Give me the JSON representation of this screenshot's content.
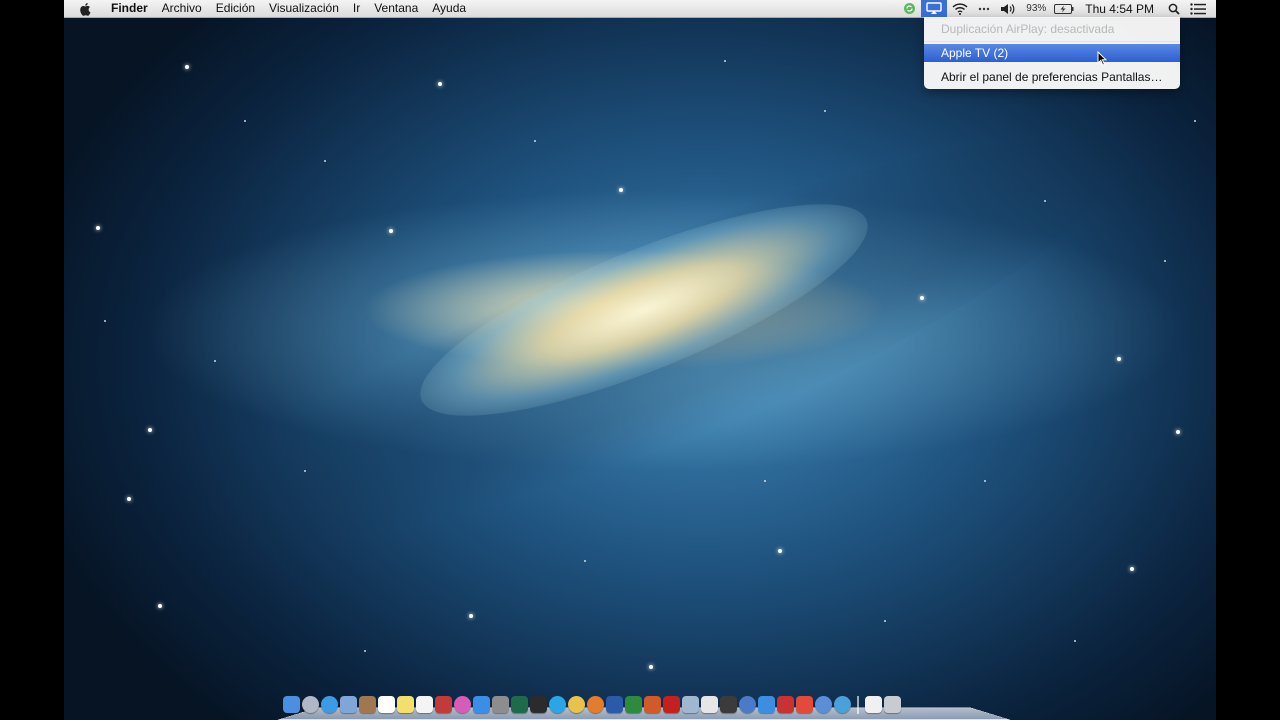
{
  "menubar": {
    "apple_icon": "apple-logo-icon",
    "app_name": "Finder",
    "items": [
      "Archivo",
      "Edición",
      "Visualización",
      "Ir",
      "Ventana",
      "Ayuda"
    ]
  },
  "status_bar": {
    "icons": [
      "sync-icon",
      "airplay-icon",
      "wifi-icon",
      "bluetooth-icon",
      "volume-icon"
    ],
    "battery_percent": "93%",
    "battery_icon": "battery-charging-icon",
    "clock": "Thu 4:54 PM",
    "spotlight_icon": "spotlight-search-icon",
    "notifications_icon": "notification-center-icon"
  },
  "airplay_menu": {
    "disabled_item": "Duplicación AirPlay: desactivada",
    "highlighted_item": "Apple TV (2)",
    "normal_item": "Abrir el panel de preferencias Pantallas…"
  },
  "dock": {
    "icons": [
      {
        "name": "finder-icon",
        "color": "#4a8fe0"
      },
      {
        "name": "launchpad-icon",
        "color": "#b0b8c8"
      },
      {
        "name": "safari-icon",
        "color": "#3d9be6"
      },
      {
        "name": "mail-icon",
        "color": "#7fa6d6"
      },
      {
        "name": "contacts-icon",
        "color": "#a07850"
      },
      {
        "name": "calendar-icon",
        "color": "#ffffff"
      },
      {
        "name": "notes-icon",
        "color": "#f3df6b"
      },
      {
        "name": "reminders-icon",
        "color": "#f4f4f4"
      },
      {
        "name": "photo-booth-icon",
        "color": "#c43a3a"
      },
      {
        "name": "itunes-icon",
        "color": "#d95bb8"
      },
      {
        "name": "app-store-icon",
        "color": "#3a8ee6"
      },
      {
        "name": "system-preferences-icon",
        "color": "#8d8d8d"
      },
      {
        "name": "audition-icon",
        "color": "#1e6b4a"
      },
      {
        "name": "terminal-icon",
        "color": "#2b2b2b"
      },
      {
        "name": "skype-icon",
        "color": "#2aa6e6"
      },
      {
        "name": "chrome-icon",
        "color": "#e8c24a"
      },
      {
        "name": "firefox-icon",
        "color": "#e57c2c"
      },
      {
        "name": "word-icon",
        "color": "#2a5aa8"
      },
      {
        "name": "excel-icon",
        "color": "#2e8a3e"
      },
      {
        "name": "powerpoint-icon",
        "color": "#d05a2a"
      },
      {
        "name": "acrobat-icon",
        "color": "#c42020"
      },
      {
        "name": "preview-icon",
        "color": "#9fb8d0"
      },
      {
        "name": "textedit-icon",
        "color": "#e6e6e6"
      },
      {
        "name": "dashboard-icon",
        "color": "#3b3b3b"
      },
      {
        "name": "quicktime-icon",
        "color": "#4a7ac8"
      },
      {
        "name": "dropbox-icon",
        "color": "#3d8ee0"
      },
      {
        "name": "filezilla-icon",
        "color": "#c83232"
      },
      {
        "name": "wunderlist-icon",
        "color": "#e24a3a"
      },
      {
        "name": "network-icon",
        "color": "#5a8fd8"
      },
      {
        "name": "globe-icon",
        "color": "#4aa0d8"
      }
    ],
    "right_icons": [
      {
        "name": "documents-stack-icon",
        "color": "#f0f0f0"
      },
      {
        "name": "trash-icon",
        "color": "#c8ccd2"
      }
    ]
  }
}
